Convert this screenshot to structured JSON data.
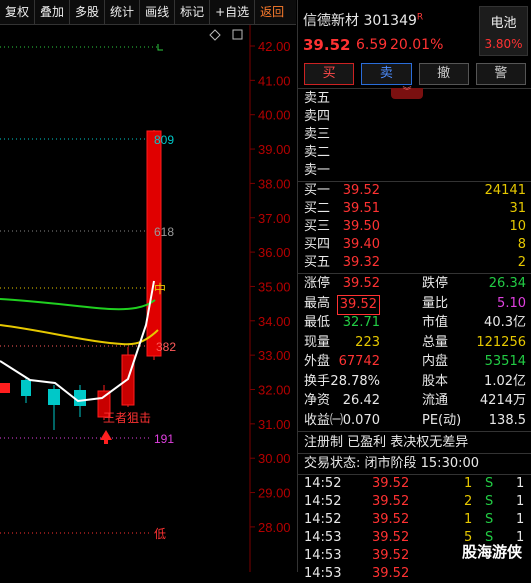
{
  "toolbar": {
    "buttons": [
      "复权",
      "叠加",
      "多股",
      "统计",
      "画线",
      "标记",
      "+自选"
    ],
    "back_label": "返回"
  },
  "chart": {
    "price_ticks": [
      "42.00",
      "41.00",
      "40.00",
      "39.00",
      "38.00",
      "37.00",
      "36.00",
      "35.00",
      "34.00",
      "33.00",
      "32.00",
      "31.00",
      "30.00",
      "29.00",
      "28.00"
    ],
    "fib_labels": [
      "809",
      "618",
      "中",
      "382",
      "191",
      "低"
    ],
    "annotation": "王者狙击",
    "diamond_icon": "diamond-icon",
    "colors": {
      "up": "#ff1e1e",
      "down": "#00c8c8",
      "ma_yellow": "#e6c800",
      "ma_green": "#20d020",
      "ma_white": "#ffffff"
    }
  },
  "stock": {
    "name": "信德新材",
    "code": "301349",
    "flag": "R",
    "price": "39.52",
    "change": "6.59",
    "change_pct": "20.01%",
    "sector": "电池",
    "sector_pct": "3.80%"
  },
  "trade_buttons": [
    "买",
    "卖",
    "撤",
    "警"
  ],
  "asks": [
    {
      "label": "卖五",
      "price": "",
      "vol": ""
    },
    {
      "label": "卖四",
      "price": "",
      "vol": ""
    },
    {
      "label": "卖三",
      "price": "",
      "vol": ""
    },
    {
      "label": "卖二",
      "price": "",
      "vol": ""
    },
    {
      "label": "卖一",
      "price": "",
      "vol": ""
    }
  ],
  "bids": [
    {
      "label": "买一",
      "price": "39.52",
      "vol": "24141"
    },
    {
      "label": "买二",
      "price": "39.51",
      "vol": "31"
    },
    {
      "label": "买三",
      "price": "39.50",
      "vol": "10"
    },
    {
      "label": "买四",
      "price": "39.40",
      "vol": "8"
    },
    {
      "label": "买五",
      "price": "39.32",
      "vol": "2"
    }
  ],
  "stats": [
    {
      "l1": "涨停",
      "v1": "39.52",
      "l2": "跌停",
      "v2": "26.34"
    },
    {
      "l1": "最高",
      "v1": "39.52",
      "l2": "量比",
      "v2": "5.10"
    },
    {
      "l1": "最低",
      "v1": "32.71",
      "l2": "市值",
      "v2": "40.3亿"
    },
    {
      "l1": "现量",
      "v1": "223",
      "l2": "总量",
      "v2": "121256"
    },
    {
      "l1": "外盘",
      "v1": "67742",
      "l2": "内盘",
      "v2": "53514"
    },
    {
      "l1": "换手",
      "v1": "28.78%",
      "l2": "股本",
      "v2": "1.02亿"
    },
    {
      "l1": "净资",
      "v1": "26.42",
      "l2": "流通",
      "v2": "4214万"
    },
    {
      "l1": "收益㈠",
      "v1": "0.070",
      "l2": "PE(动)",
      "v2": "138.5"
    }
  ],
  "info_line": "注册制 已盈利 表决权无差异",
  "status_line": "交易状态: 闭市阶段 15:30:00",
  "ticks": [
    {
      "time": "14:52",
      "price": "39.52",
      "vol": "1",
      "side": "S",
      "num": "1"
    },
    {
      "time": "14:52",
      "price": "39.52",
      "vol": "2",
      "side": "S",
      "num": "1"
    },
    {
      "time": "14:52",
      "price": "39.52",
      "vol": "1",
      "side": "S",
      "num": "1"
    },
    {
      "time": "14:53",
      "price": "39.52",
      "vol": "5",
      "side": "S",
      "num": "1"
    },
    {
      "time": "14:53",
      "price": "39.52",
      "vol": "",
      "side": "",
      "num": ""
    },
    {
      "time": "14:53",
      "price": "39.52",
      "vol": "",
      "side": "",
      "num": ""
    }
  ],
  "watermark": "股海游侠"
}
